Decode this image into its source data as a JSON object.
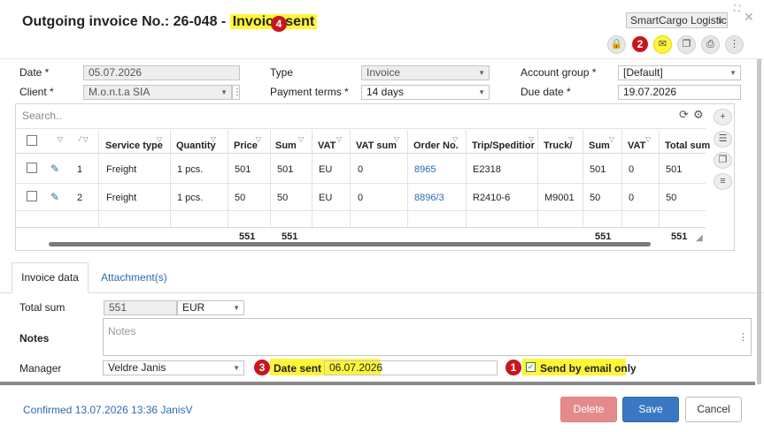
{
  "header": {
    "title_prefix": "Outgoing invoice No.: 26-048 - ",
    "status": "Invoice sent",
    "company": "SmartCargo Logistics",
    "badges": {
      "b1": "1",
      "b2": "2",
      "b3": "3",
      "b4": "4"
    }
  },
  "form": {
    "date_label": "Date *",
    "date_value": "05.07.2026",
    "client_label": "Client *",
    "client_value": "M.o.n.t.a SIA",
    "type_label": "Type",
    "type_value": "Invoice",
    "terms_label": "Payment terms *",
    "terms_value": "14 days",
    "account_label": "Account group *",
    "account_value": "[Default]",
    "due_label": "Due date *",
    "due_value": "19.07.2026"
  },
  "grid": {
    "search_placeholder": "Search..",
    "columns": [
      "Service type",
      "Quantity",
      "Price",
      "Sum",
      "VAT",
      "VAT sum",
      "Order No.",
      "Trip/Speditior",
      "Truck/",
      "Sum",
      "VAT",
      "Total sum"
    ],
    "rows": [
      {
        "n": "1",
        "service": "Freight",
        "qty": "1 pcs.",
        "price": "501",
        "sum": "501",
        "vat": "EU",
        "vat_sum": "0",
        "order": "8965",
        "trip": "E2318",
        "truck": "",
        "sum2": "501",
        "vat2": "0",
        "total": "501"
      },
      {
        "n": "2",
        "service": "Freight",
        "qty": "1 pcs.",
        "price": "50",
        "sum": "50",
        "vat": "EU",
        "vat_sum": "0",
        "order": "8896/3",
        "trip": "R2410-6",
        "truck": "M9001",
        "sum2": "50",
        "vat2": "0",
        "total": "50"
      }
    ],
    "footer": {
      "price": "551",
      "sum": "551",
      "sum2": "551",
      "total": "551"
    }
  },
  "tabs": {
    "invoice_data": "Invoice data",
    "attachments": "Attachment(s)"
  },
  "details": {
    "total_label": "Total sum",
    "total_value": "551",
    "currency": "EUR",
    "notes_label": "Notes",
    "notes_placeholder": "Notes",
    "manager_label": "Manager",
    "manager_value": "Veldre Janis",
    "date_sent_label": "Date sent",
    "date_sent_value": "06.07.2026",
    "email_only_label": "Send by email only"
  },
  "footer": {
    "confirmed": "Confirmed 13.07.2026 13:36 JanisV",
    "delete": "Delete",
    "save": "Save",
    "cancel": "Cancel"
  },
  "colors": {
    "accent": "#2a6bb0",
    "highlight": "#fff63b",
    "badge": "#c8161d",
    "delete": "#e58a8a",
    "save": "#3b78c3"
  }
}
